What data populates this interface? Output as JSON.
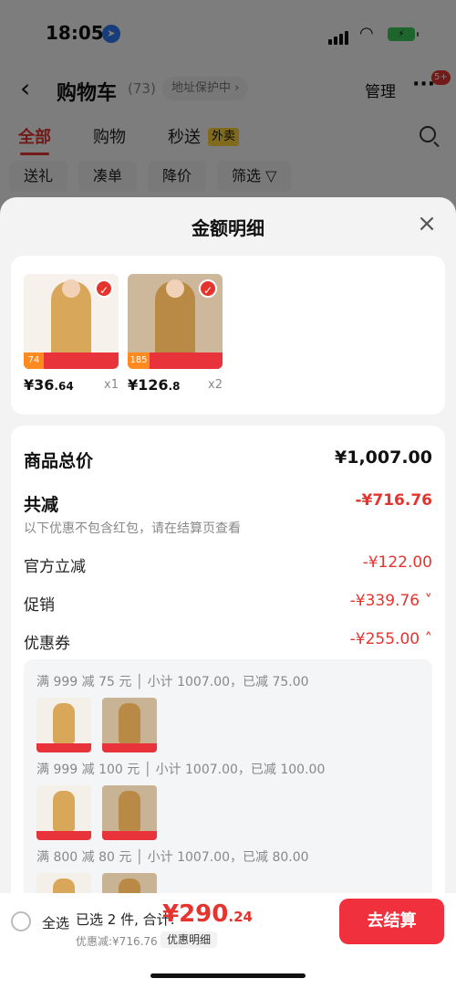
{
  "status_bar": {
    "time": "18:05"
  },
  "header": {
    "back_icon": "chevron-left-icon",
    "title": "购物车",
    "count": "(73)",
    "address": "地址保护中 ›",
    "manage": "管理",
    "more_badge": "5+"
  },
  "tabs": [
    {
      "label": "全部",
      "active": true
    },
    {
      "label": "购物",
      "active": false
    },
    {
      "label": "秒送",
      "active": false
    }
  ],
  "tab_tag": "外卖",
  "chips": [
    "送礼",
    "凑单",
    "降价",
    "筛选 ▽"
  ],
  "sheet": {
    "title": "金额明细",
    "close_icon": "close-icon",
    "products": [
      {
        "price_main": "¥36",
        "price_cents": ".64",
        "qty": "x1",
        "badge": "74"
      },
      {
        "price_main": "¥126",
        "price_cents": ".8",
        "qty": "x2",
        "badge": "185"
      }
    ],
    "total_label": "商品总价",
    "total_value": "¥1,007.00",
    "reduce_label": "共减",
    "reduce_value": "-¥716.76",
    "reduce_note": "以下优惠不包含红包，请在结算页查看",
    "official_label": "官方立减",
    "official_value": "-¥122.00",
    "promo_label": "促销",
    "promo_value": "-¥339.76 ˅",
    "coupon_label": "优惠券",
    "coupon_value": "-¥255.00 ˄",
    "coupons": [
      {
        "text": "满 999 减 75 元 │ 小计 1007.00，已减 75.00"
      },
      {
        "text": "满 999 减 100 元 │ 小计 1007.00，已减 100.00"
      },
      {
        "text": "满 800 减 80 元 │ 小计 1007.00，已减 80.00"
      }
    ]
  },
  "footer": {
    "select_all": "全选",
    "summary": "已选 2 件, 合计:",
    "total_main": "¥290",
    "total_cents": ".24",
    "discount_note": "优惠减:¥716.76",
    "detail_button": "优惠明细",
    "checkout": "去结算"
  },
  "colors": {
    "accent": "#e5342e",
    "checkout": "#f0303c"
  }
}
